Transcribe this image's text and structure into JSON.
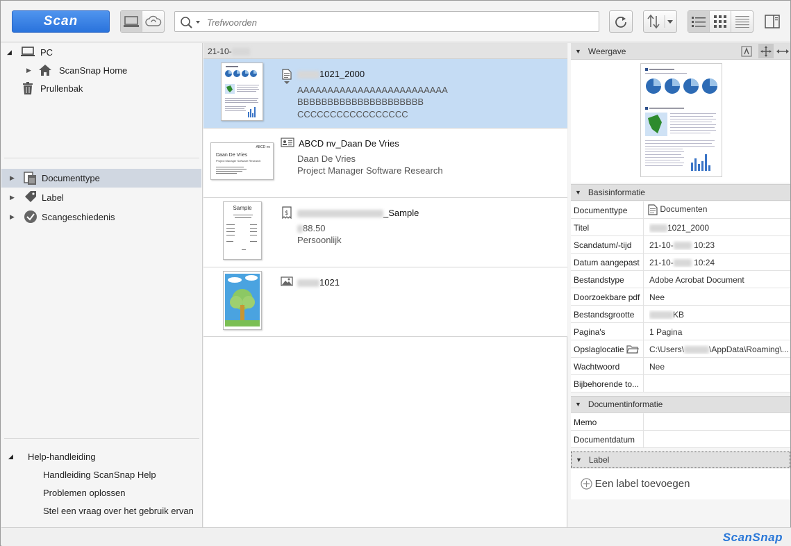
{
  "toolbar": {
    "scan_label": "Scan",
    "search_placeholder": "Trefwoorden",
    "icons": [
      "pc-view-icon",
      "cloud-sync-icon",
      "search-icon",
      "refresh-icon",
      "sort-icon",
      "list-view-icon",
      "thumbnail-view-icon",
      "detail-list-icon",
      "panel-toggle-icon"
    ]
  },
  "left": {
    "tree": [
      {
        "label": "PC",
        "icon": "computer-icon"
      },
      {
        "label": "ScanSnap Home",
        "icon": "home-icon"
      },
      {
        "label": "Prullenbak",
        "icon": "trash-icon"
      }
    ],
    "filters": [
      {
        "label": "Documenttype",
        "icon": "document-type-icon"
      },
      {
        "label": "Label",
        "icon": "tag-icon"
      },
      {
        "label": "Scangeschiedenis",
        "icon": "history-icon"
      }
    ],
    "help": {
      "title": "Help-handleiding",
      "links": [
        "Handleiding ScanSnap Help",
        "Problemen oplossen",
        "Stel een vraag over het gebruik ervan"
      ]
    }
  },
  "list": {
    "date_header": "21-10-",
    "items": [
      {
        "title_suffix": "1021_2000",
        "lines": [
          "AAAAAAAAAAAAAAAAAAAAAAAAA",
          "BBBBBBBBBBBBBBBBBBBBB",
          "CCCCCCCCCCCCCCCCC"
        ],
        "icon": "document-icon"
      },
      {
        "title": "ABCD nv_Daan De Vries",
        "lines": [
          "Daan De Vries",
          "Project Manager Software Research"
        ],
        "icon": "business-card-icon",
        "thumb_name": "Daan De Vries",
        "thumb_sub": "Project Manager Software Research",
        "thumb_brand": "ABCD nv"
      },
      {
        "title_suffix": "_Sample",
        "lines": [
          "88.50",
          "Persoonlijk"
        ],
        "icon": "receipt-icon",
        "thumb_title": "Sample"
      },
      {
        "title_suffix": "1021",
        "lines": [],
        "icon": "photo-icon"
      }
    ]
  },
  "right": {
    "preview_header": "Weergave",
    "basic_header": "Basisinformatie",
    "basic": [
      {
        "k": "Documenttype",
        "v": "Documenten"
      },
      {
        "k": "Titel",
        "v": "1021_2000"
      },
      {
        "k": "Scandatum/-tijd",
        "v": "21-10-",
        "v2": "10:23"
      },
      {
        "k": "Datum aangepast",
        "v": "21-10-",
        "v2": "10:24"
      },
      {
        "k": "Bestandstype",
        "v": "Adobe Acrobat Document"
      },
      {
        "k": "Doorzoekbare pdf",
        "v": "Nee"
      },
      {
        "k": "Bestandsgrootte",
        "v": "KB"
      },
      {
        "k": "Pagina's",
        "v": "1 Pagina"
      },
      {
        "k": "Opslaglocatie",
        "v": "C:\\Users\\",
        "v2": "\\AppData\\Roaming\\..."
      },
      {
        "k": "Wachtwoord",
        "v": "Nee"
      },
      {
        "k": "Bijbehorende to...",
        "v": ""
      }
    ],
    "docinfo_header": "Documentinformatie",
    "docinfo": [
      {
        "k": "Memo",
        "v": ""
      },
      {
        "k": "Documentdatum",
        "v": ""
      }
    ],
    "label_header": "Label",
    "add_label": "Een label toevoegen"
  },
  "status": {
    "logo": "ScanSnap"
  }
}
